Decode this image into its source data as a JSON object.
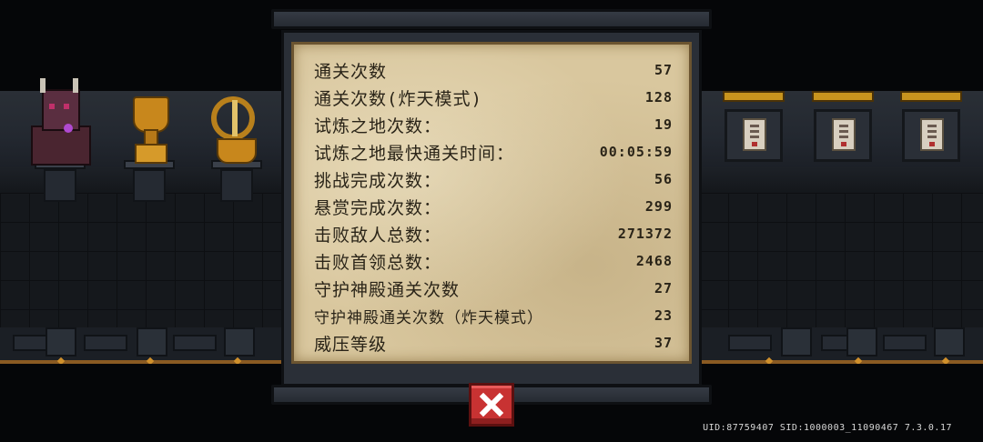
{
  "stats": [
    {
      "label": "通关次数",
      "value": "57"
    },
    {
      "label": "通关次数(炸天模式)",
      "value": "128"
    },
    {
      "label": "试炼之地次数：",
      "value": "19"
    },
    {
      "label": "试炼之地最快通关时间：",
      "value": "00:05:59"
    },
    {
      "label": "挑战完成次数：",
      "value": "56"
    },
    {
      "label": "悬赏完成次数：",
      "value": "299"
    },
    {
      "label": "击败敌人总数：",
      "value": "271372"
    },
    {
      "label": "击败首领总数：",
      "value": "2468"
    },
    {
      "label": "守护神殿通关次数",
      "value": "27"
    },
    {
      "label": "守护神殿通关次数（炸天模式）",
      "value": "23"
    },
    {
      "label": "威压等级",
      "value": "37"
    }
  ],
  "footer": {
    "uid_text": "UID:87759407 SID:1000003_11090467 7.3.0.17"
  },
  "icons": {
    "close": "close-x-icon"
  },
  "colors": {
    "parchment": "#d9c79e",
    "close_button": "#c83232",
    "gold": "#c8871c"
  }
}
